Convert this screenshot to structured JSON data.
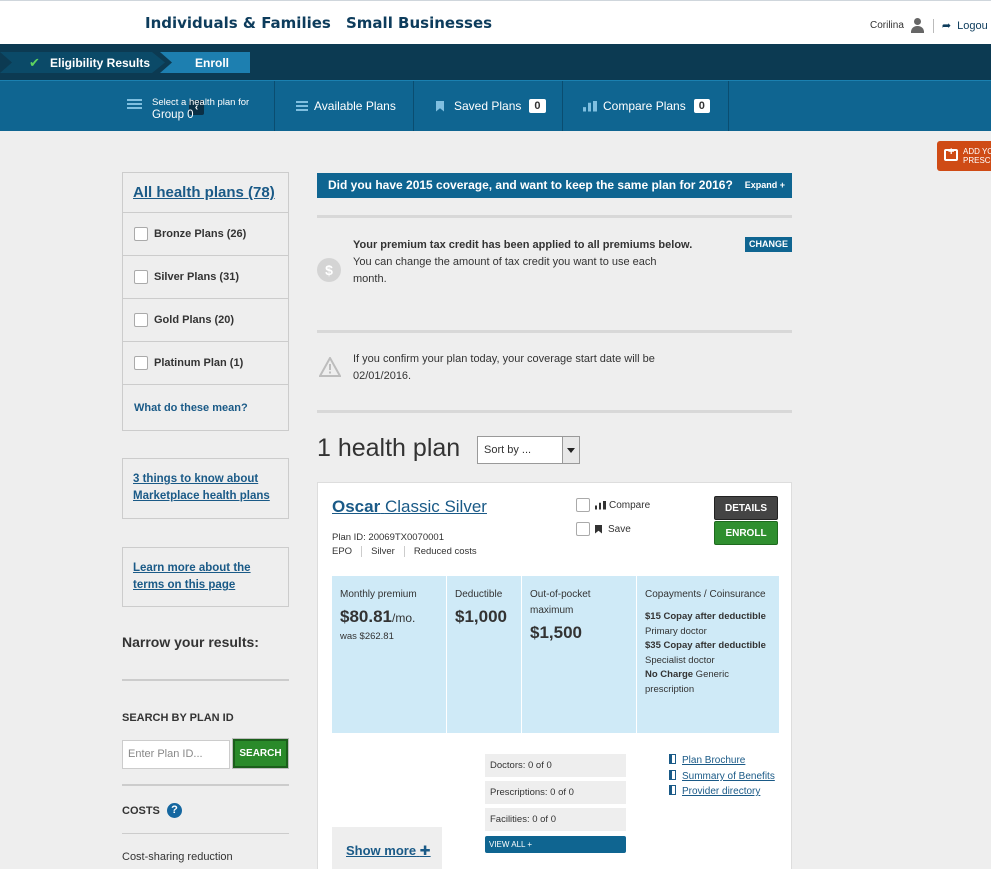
{
  "header": {
    "nav_individuals": "Individuals & Families",
    "nav_small_business": "Small Businesses",
    "user_name": "Corilina",
    "logout": "Logou"
  },
  "progress": {
    "steps": [
      {
        "label": "Eligibility Results",
        "status": "complete"
      },
      {
        "label": "Enroll",
        "status": "current"
      }
    ]
  },
  "subnav": {
    "select_plan_line1": "Select a health plan for",
    "select_plan_line2": "Group 0",
    "available_plans": "Available Plans",
    "saved_plans": "Saved Plans",
    "saved_count": "0",
    "compare_plans": "Compare Plans",
    "compare_count": "0"
  },
  "rx_tab": {
    "line1": "ADD YO",
    "line2": "PRESC"
  },
  "filters": {
    "all": "All health plans (78)",
    "items": [
      {
        "label": "Bronze Plans (26)"
      },
      {
        "label": "Silver Plans (31)"
      },
      {
        "label": "Gold Plans (20)"
      },
      {
        "label": "Platinum Plan (1)"
      }
    ],
    "what_mean": "What do these mean?"
  },
  "sidebar": {
    "three_things": "3 things to know about Marketplace health plans",
    "learn_more": "Learn more about the terms on this page",
    "narrow": "Narrow your results:",
    "search_by_id": "SEARCH BY PLAN ID",
    "plan_id_placeholder": "Enter Plan ID...",
    "search_btn": "SEARCH",
    "costs": "COSTS",
    "cost_sharing": "Cost-sharing reduction"
  },
  "main": {
    "banner": "Did you have 2015 coverage, and want to keep the same plan for 2016?",
    "banner_expand": "Expand +",
    "tax_bold": "Your premium tax credit has been applied to all premiums below.",
    "tax_text": "You can change the amount of tax credit you want to use each month.",
    "change_btn": "CHANGE",
    "coverage_notice": "If you confirm your plan today, your coverage start date will be 02/01/2016.",
    "count_title": "1 health plan",
    "sort_label": "Sort by ..."
  },
  "plan": {
    "brand": "Oscar",
    "name": "Classic Silver",
    "plan_id": "Plan ID: 20069TX0070001",
    "tags": [
      "EPO",
      "Silver",
      "Reduced costs"
    ],
    "compare": "Compare",
    "save": "Save",
    "details_btn": "DETAILS",
    "enroll_btn": "ENROLL",
    "monthly_label": "Monthly premium",
    "monthly_value": "$80.81",
    "monthly_unit": "/mo.",
    "was": "was $262.81",
    "deductible_label": "Deductible",
    "deductible_value": "$1,000",
    "oop_label": "Out-of-pocket maximum",
    "oop_value": "$1,500",
    "copay_label": "Copayments / Coinsurance",
    "copay_1_bold": "$15 Copay after deductible",
    "copay_1_text": " Primary doctor",
    "copay_2_bold": "$35 Copay after deductible",
    "copay_2_text": " Specialist doctor",
    "copay_3_bold": "No Charge",
    "copay_3_text": " Generic prescription",
    "doctors": "Doctors: 0 of 0",
    "prescriptions": "Prescriptions: 0 of 0",
    "facilities": "Facilities: 0 of 0",
    "view_all": "VIEW ALL +",
    "brochure": "Plan Brochure",
    "summary": "Summary of Benefits",
    "directory": "Provider directory",
    "show_more": "Show more"
  }
}
